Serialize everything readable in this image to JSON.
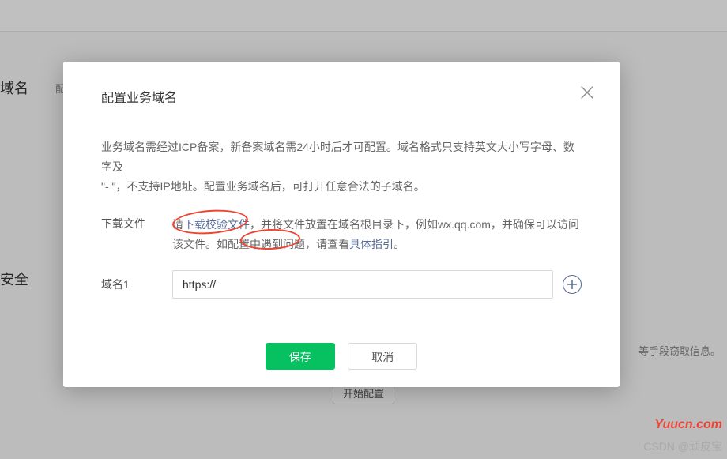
{
  "background": {
    "heading1": "域名",
    "sub1": "配置业务域名",
    "heading2": "安全",
    "note": "等手段窃取信息。",
    "bgBtn": "开始配置"
  },
  "modal": {
    "title": "配置业务域名",
    "noticeLine1": "业务域名需经过ICP备案，新备案域名需24小时后才可配置。域名格式只支持英文大小写字母、数字及",
    "noticeLine2": "\"- \"，不支持IP地址。配置业务域名后，可打开任意合法的子域名。",
    "download": {
      "label": "下载文件",
      "pre": "请",
      "link1": "下载校验文件",
      "mid": "，并将文件放置在域名根目录下，例如wx.qq.com，并确保可以访问该文件。如配置中遇到问题，请查看",
      "link2": "具体指引",
      "post": "。"
    },
    "domain": {
      "label": "域名1",
      "value": "https://"
    },
    "footer": {
      "save": "保存",
      "cancel": "取消"
    }
  },
  "watermark": {
    "wm1": "Yuucn.com",
    "wm2": "CSDN @顽皮宝"
  }
}
